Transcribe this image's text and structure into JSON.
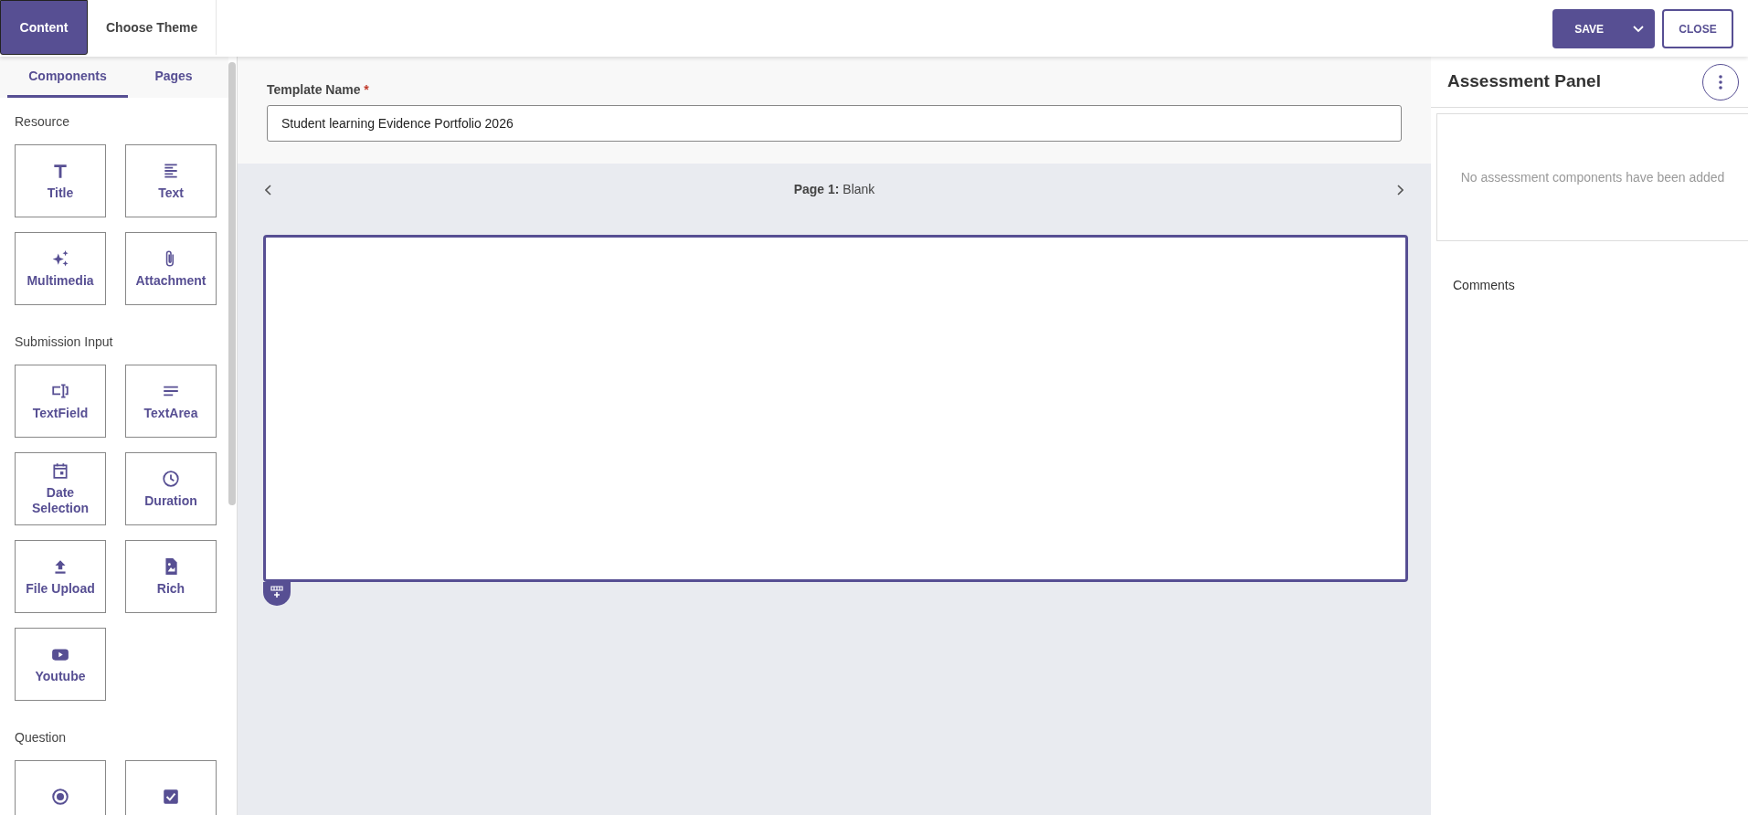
{
  "top_tabs": [
    {
      "label": "Content",
      "selected": true
    },
    {
      "label": "Choose Theme",
      "selected": false
    }
  ],
  "actions": {
    "save": "SAVE",
    "close": "CLOSE"
  },
  "sidebar": {
    "tabs": [
      {
        "label": "Components",
        "selected": true
      },
      {
        "label": "Pages",
        "selected": false
      }
    ],
    "groups": [
      {
        "title": "Resource",
        "items": [
          {
            "kind": "title",
            "label": "Title"
          },
          {
            "kind": "text",
            "label": "Text"
          },
          {
            "kind": "multimedia",
            "label": "Multimedia"
          },
          {
            "kind": "attachment",
            "label": "Attachment"
          }
        ]
      },
      {
        "title": "Submission Input",
        "items": [
          {
            "kind": "textfield",
            "label": "TextField"
          },
          {
            "kind": "textarea",
            "label": "TextArea"
          },
          {
            "kind": "date",
            "label": "Date Selection"
          },
          {
            "kind": "duration",
            "label": "Duration"
          },
          {
            "kind": "upload",
            "label": "File Upload"
          },
          {
            "kind": "rich",
            "label": "Rich"
          },
          {
            "kind": "youtube",
            "label": "Youtube"
          }
        ]
      },
      {
        "title": "Question",
        "items": [
          {
            "kind": "radio"
          },
          {
            "kind": "checkbox"
          }
        ]
      }
    ]
  },
  "template": {
    "label": "Template Name",
    "required_mark": "*",
    "value": "Student learning Evidence Portfolio 2026"
  },
  "pager": {
    "prefix": "Page 1:",
    "name": "Blank"
  },
  "assessment_panel": {
    "title": "Assessment Panel",
    "empty_message": "No assessment components have been added",
    "comments_label": "Comments"
  }
}
